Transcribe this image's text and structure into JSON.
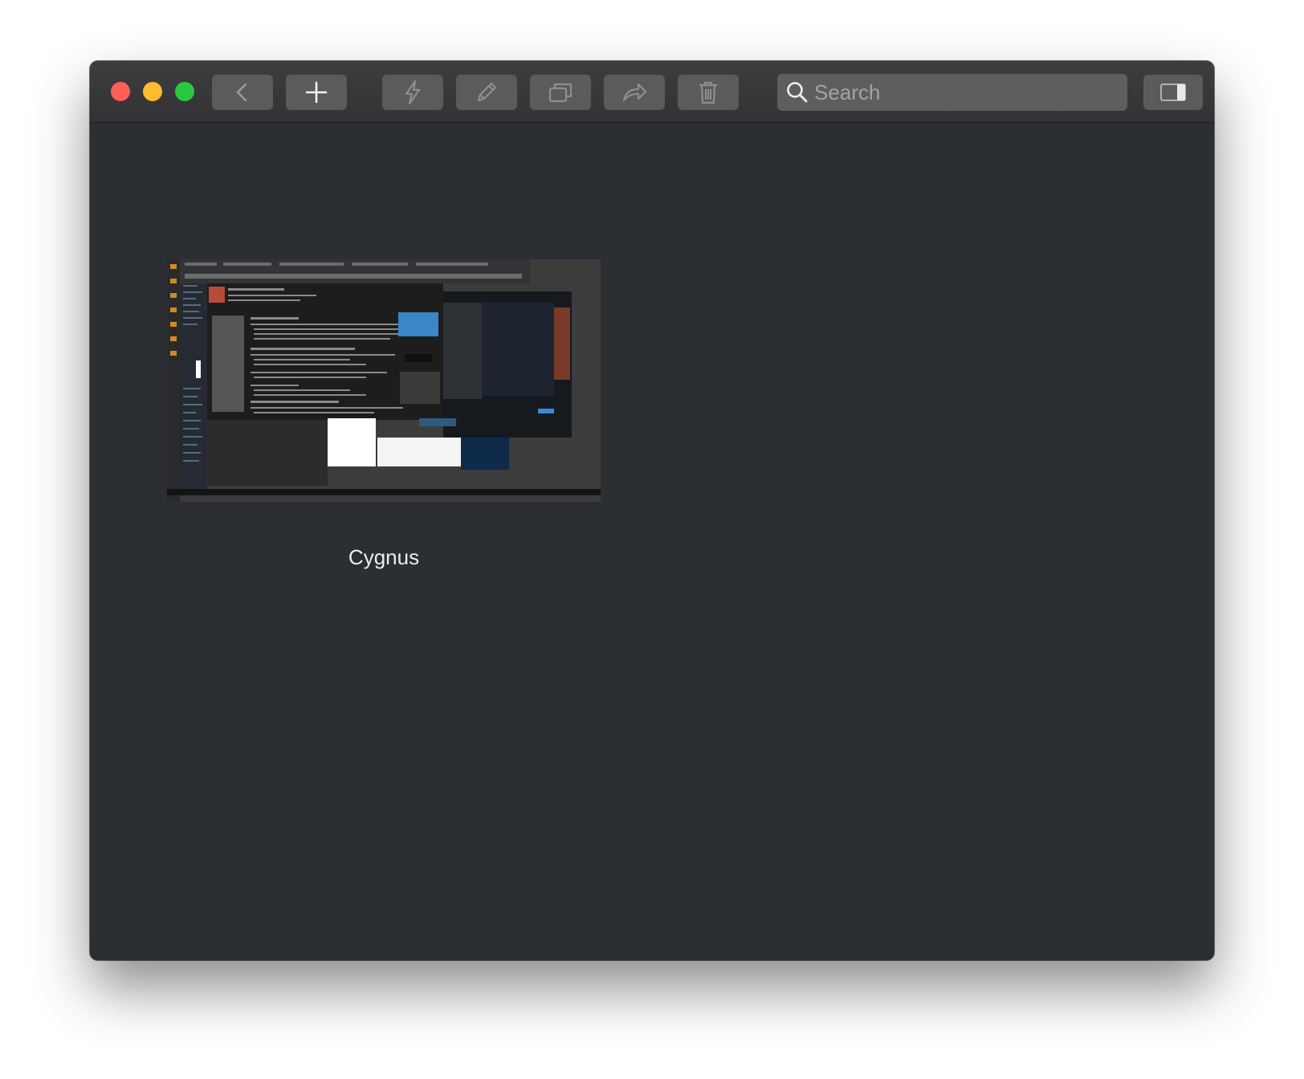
{
  "toolbar": {
    "back_icon": "chevron-left-icon",
    "add_icon": "plus-icon",
    "quick_action_icon": "lightning-icon",
    "edit_icon": "pencil-icon",
    "duplicate_icon": "windows-icon",
    "share_icon": "share-arrow-icon",
    "delete_icon": "trash-icon",
    "sidebar_icon": "sidebar-toggle-icon"
  },
  "search": {
    "placeholder": "Search"
  },
  "items": [
    {
      "label": "Cygnus"
    }
  ],
  "colors": {
    "close": "#fe5f57",
    "minimize": "#febc2e",
    "zoom": "#28c840",
    "window_bg": "#2b2e32",
    "toolbar_button": "#5b5b5d"
  }
}
